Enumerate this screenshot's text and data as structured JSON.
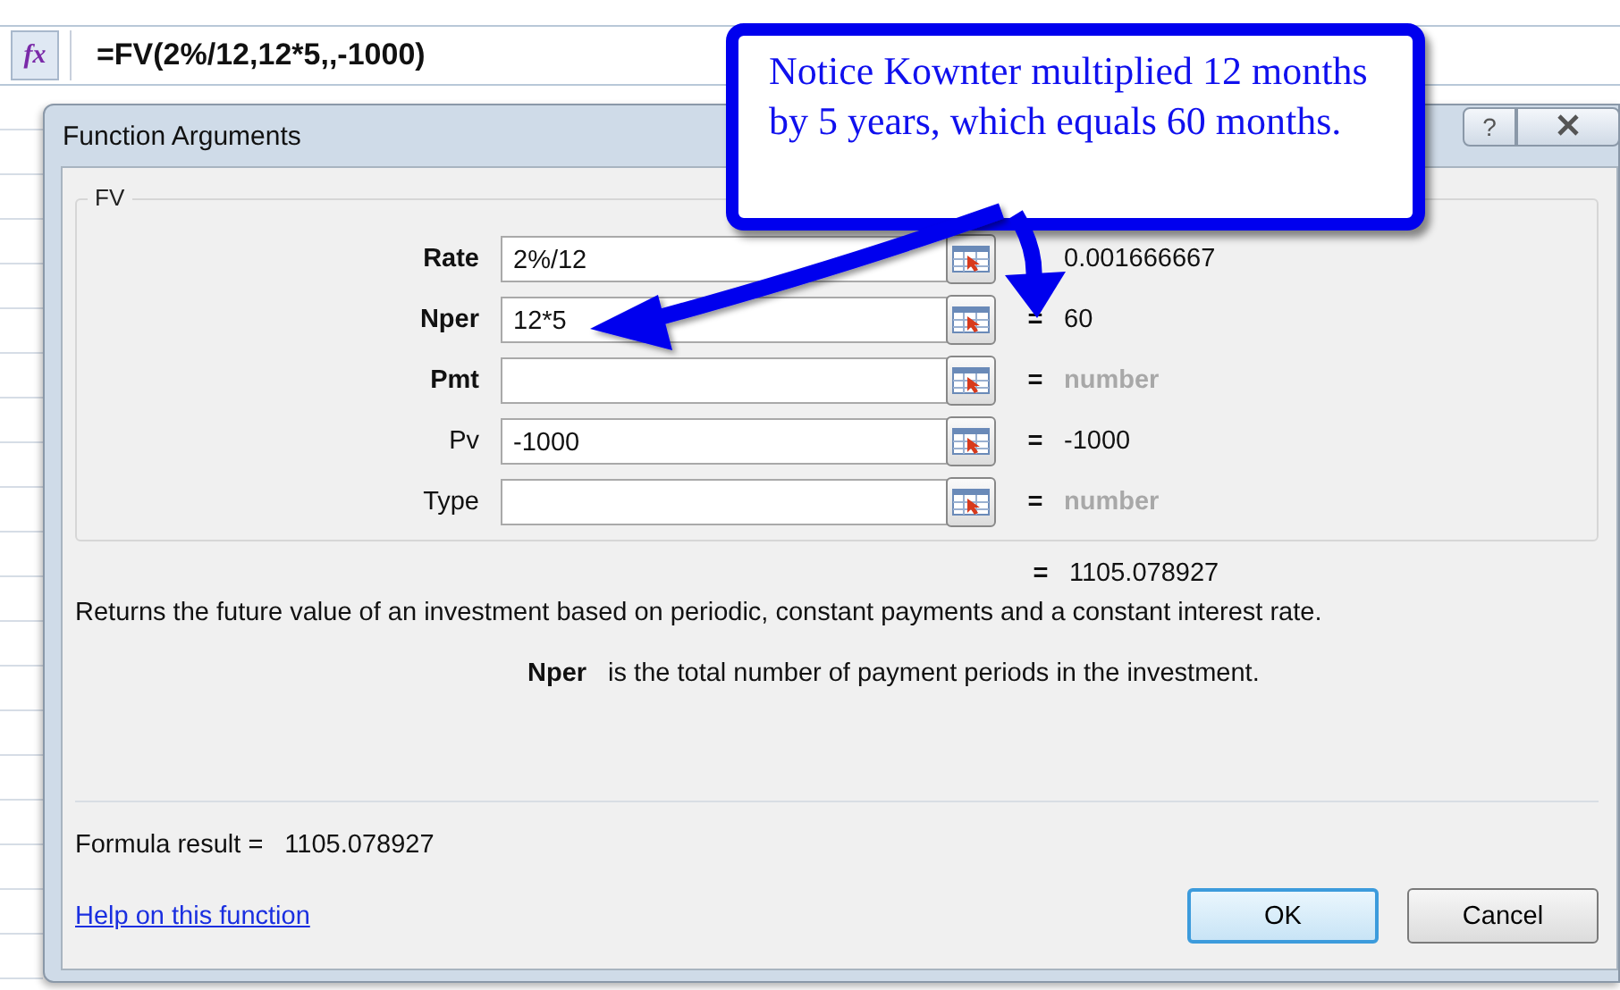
{
  "formula_bar": {
    "button": "fx",
    "formula": "=FV(2%/12,12*5,,-1000)"
  },
  "dialog": {
    "title": "Function Arguments",
    "help_button": "?",
    "group": {
      "title": "FV",
      "arguments": [
        {
          "label": "Rate",
          "required": true,
          "value": "2%/12",
          "result": "0.001666667",
          "hint": false
        },
        {
          "label": "Nper",
          "required": true,
          "value": "12*5",
          "equals": "=",
          "result": "60",
          "hint": false
        },
        {
          "label": "Pmt",
          "required": true,
          "equals": "=",
          "result": "number",
          "hint": true
        },
        {
          "label": "Pv",
          "required": false,
          "value": "-1000",
          "equals": "=",
          "result": "-1000",
          "hint": false
        },
        {
          "label": "Type",
          "required": false,
          "equals": "=",
          "result": "number",
          "hint": true
        }
      ]
    },
    "result_equals": "=",
    "result": "1105.078927",
    "description": "Returns the future value of an investment based on periodic, constant payments and a constant interest rate.",
    "argument_help": {
      "name": "Nper",
      "text": "is the total number of payment periods in the investment."
    },
    "formula_result_label": "Formula result =",
    "formula_result": "1105.078927",
    "help_link": "Help on this function",
    "buttons": [
      {
        "label": "OK",
        "default": true
      },
      {
        "label": "Cancel",
        "default": false
      }
    ]
  },
  "callout": {
    "text": "Notice Kownter multiplied 12 months by 5 years, which equals 60 months."
  }
}
